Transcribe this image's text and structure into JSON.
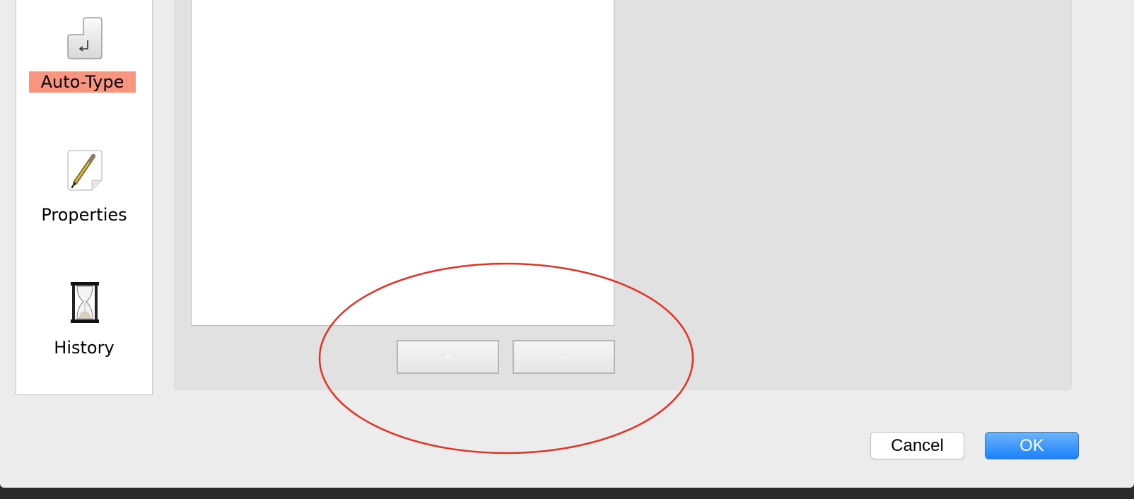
{
  "sidebar": {
    "items": [
      {
        "label": "Auto-Type",
        "icon": "keyboard-return-key-icon",
        "selected": true
      },
      {
        "label": "Properties",
        "icon": "document-pencil-icon",
        "selected": false
      },
      {
        "label": "History",
        "icon": "hourglass-icon",
        "selected": false
      }
    ]
  },
  "association_list": {
    "add_label": "+",
    "remove_label": "-"
  },
  "dialog": {
    "cancel_label": "Cancel",
    "ok_label": "OK"
  },
  "colors": {
    "selected_highlight": "#f7957f",
    "accent_blue": "#1a82fb",
    "annotation_red": "#e33224"
  }
}
